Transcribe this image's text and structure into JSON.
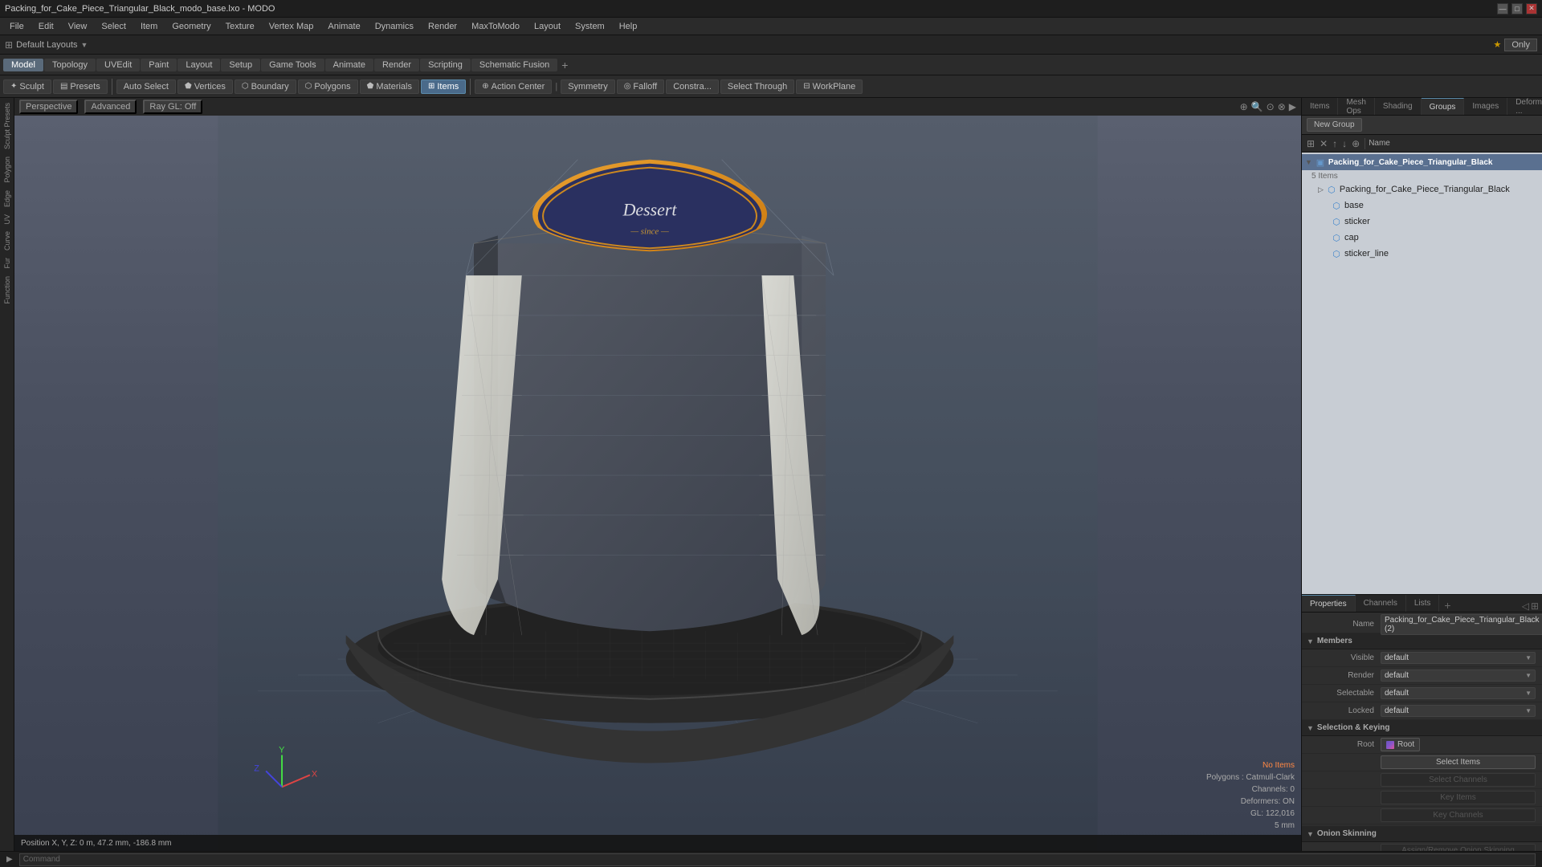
{
  "titlebar": {
    "title": "Packing_for_Cake_Piece_Triangular_Black_modo_base.lxo - MODO",
    "controls": [
      "—",
      "□",
      "✕"
    ]
  },
  "menubar": {
    "items": [
      "File",
      "Edit",
      "View",
      "Select",
      "Item",
      "Geometry",
      "Texture",
      "Vertex Map",
      "Animate",
      "Dynamics",
      "Render",
      "MaxToModo",
      "Layout",
      "System",
      "Help"
    ]
  },
  "toolbar1": {
    "tabs": [
      "Model",
      "Topology",
      "UVEdit",
      "Paint",
      "Layout",
      "Setup",
      "Game Tools",
      "Animate",
      "Render",
      "Scripting",
      "Schematic Fusion"
    ],
    "plus_label": "+"
  },
  "layoutbar": {
    "icon": "⊞",
    "label": "Default Layouts",
    "dropdown_arrow": "▼",
    "star_icon": "★",
    "only_label": "Only"
  },
  "toolbar2": {
    "sculpt_label": "Sculpt",
    "presets_label": "Presets",
    "auto_select_label": "Auto Select",
    "vertices_label": "Vertices",
    "boundary_label": "Boundary",
    "polygons_label": "Polygons",
    "materials_label": "Materials",
    "items_label": "Items",
    "action_center_label": "Action Center",
    "pipe": "|",
    "symmetry_label": "Symmetry",
    "falloff_label": "Falloff",
    "constraint_label": "Constra...",
    "select_through_label": "Select Through",
    "workplane_label": "WorkPlane"
  },
  "left_sidebar": {
    "items": [
      "Sculpt Presets",
      "Polygon",
      "Edge",
      "UV",
      "Curve",
      "Fur",
      "Function"
    ]
  },
  "viewport": {
    "perspective_label": "Perspective",
    "advanced_label": "Advanced",
    "ray_gl_label": "Ray GL: Off",
    "icons": [
      "⊕",
      "🔍",
      "⊙",
      "⊗",
      "▶"
    ]
  },
  "scene_info": {
    "no_items_label": "No Items",
    "polygons_label": "Polygons : Catmull-Clark",
    "channels_label": "Channels: 0",
    "deformers_label": "Deformers: ON",
    "gl_label": "GL: 122,016",
    "units_label": "5 mm"
  },
  "position_status": "Position X, Y, Z:  0 m, 47.2 mm, -186.8 mm",
  "right_panel": {
    "tabs": [
      "Items",
      "Mesh Ops",
      "Shading",
      "Groups",
      "Images",
      "Deform ..."
    ],
    "active_tab": "Groups",
    "tab_icons": [
      "◁",
      "⊞"
    ]
  },
  "new_group": {
    "label": "New Group"
  },
  "group_toolbar": {
    "icons": [
      "⊞",
      "✕",
      "↑",
      "↓",
      "⊕"
    ],
    "name_label": "Name"
  },
  "tree": {
    "items": [
      {
        "id": "root-group",
        "label": "Packing_for_Cake_Piece_Triangular_Black",
        "count": "5 Items",
        "selected": true,
        "level": 0,
        "icon": "📦",
        "has_arrow": true,
        "eye": true
      },
      {
        "id": "item-root",
        "label": "Packing_for_Cake_Piece_Triangular_Black",
        "level": 1,
        "icon": "⬡",
        "eye": true
      },
      {
        "id": "item-base",
        "label": "base",
        "level": 2,
        "icon": "⬡",
        "eye": true
      },
      {
        "id": "item-sticker",
        "label": "sticker",
        "level": 2,
        "icon": "⬡",
        "eye": true
      },
      {
        "id": "item-cap",
        "label": "cap",
        "level": 2,
        "icon": "⬡",
        "eye": true
      },
      {
        "id": "item-sticker-line",
        "label": "sticker_line",
        "level": 2,
        "icon": "⬡",
        "eye": true
      }
    ]
  },
  "properties": {
    "tabs": [
      "Properties",
      "Channels",
      "Lists"
    ],
    "active_tab": "Properties",
    "plus_label": "+",
    "tab_icons": [
      "◁",
      "⊞"
    ],
    "name_label": "Name",
    "name_value": "Packing_for_Cake_Piece_Triangular_Black (2)",
    "members_section": "Members",
    "visible_label": "Visible",
    "visible_value": "default",
    "render_label": "Render",
    "render_value": "default",
    "selectable_label": "Selectable",
    "selectable_value": "default",
    "locked_label": "Locked",
    "locked_value": "default",
    "selection_keying_section": "Selection & Keying",
    "root_label": "Root",
    "select_items_label": "Select Items",
    "select_channels_label": "Select Channels",
    "key_items_label": "Key Items",
    "key_channels_label": "Key Channels",
    "onion_section": "Onion Skinning",
    "assign_remove_label": "Assign/Remove Onion Skinning"
  },
  "statusbar": {
    "arrow": "▶",
    "command_placeholder": "Command"
  }
}
